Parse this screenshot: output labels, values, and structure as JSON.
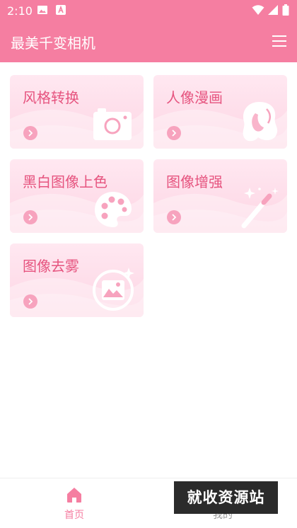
{
  "status_bar": {
    "time": "2:10",
    "icons": [
      "image-icon",
      "font-a-icon",
      "wifi-icon",
      "signal-icon",
      "battery-icon"
    ]
  },
  "app_bar": {
    "title": "最美千变相机",
    "menu_icon": "hamburger-menu-icon"
  },
  "colors": {
    "primary": "#f57ea1",
    "card_text": "#e6547f",
    "card_bg_top": "#ffe8f1",
    "card_bg_bottom": "#fdd4e3"
  },
  "cards": [
    {
      "label": "风格转换",
      "icon": "camera-icon"
    },
    {
      "label": "人像漫画",
      "icon": "portrait-hair-icon"
    },
    {
      "label": "黑白图像上色",
      "icon": "palette-icon"
    },
    {
      "label": "图像增强",
      "icon": "magic-wand-icon"
    },
    {
      "label": "图像去雾",
      "icon": "landscape-image-icon"
    }
  ],
  "bottom_nav": {
    "home_label": "首页",
    "mine_label": "我的"
  },
  "watermark": "就收资源站"
}
